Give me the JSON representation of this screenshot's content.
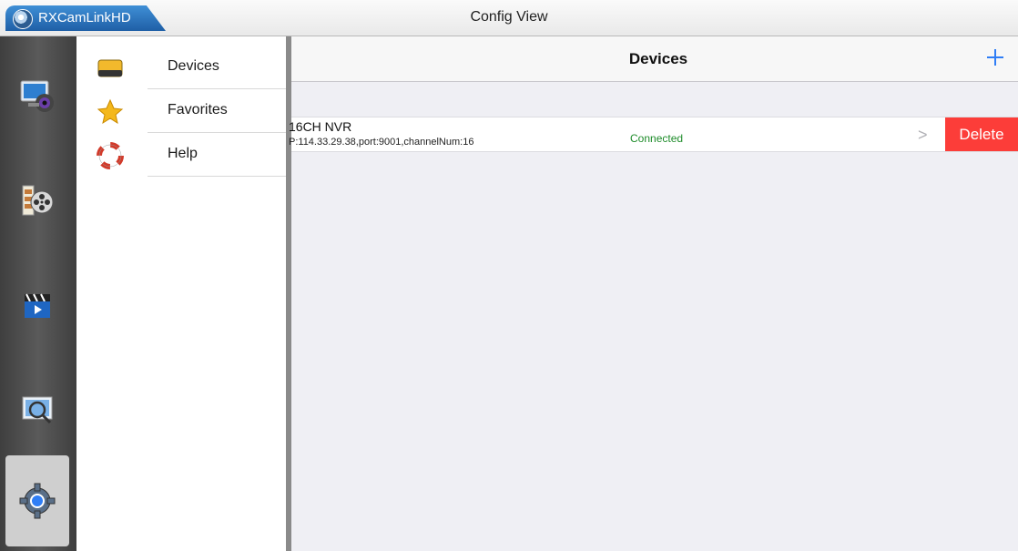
{
  "app": {
    "name": "RXCamLinkHD"
  },
  "window": {
    "title": "Config View"
  },
  "rail": {
    "items": [
      {
        "icon": "monitor-camera-icon"
      },
      {
        "icon": "film-reel-icon"
      },
      {
        "icon": "clapperboard-icon"
      },
      {
        "icon": "search-picture-icon"
      },
      {
        "icon": "settings-gear-icon",
        "active": true
      }
    ]
  },
  "menu": {
    "items": [
      {
        "label": "Devices",
        "icon": "dvr-device-icon"
      },
      {
        "label": "Favorites",
        "icon": "star-icon"
      },
      {
        "label": "Help",
        "icon": "lifebuoy-icon"
      }
    ]
  },
  "main": {
    "title": "Devices",
    "add_icon": "plus-icon",
    "devices": [
      {
        "name": "16CH NVR",
        "info": "P:114.33.29.38,port:9001,channelNum:16",
        "status": "Connected",
        "delete_label": "Delete",
        "chevron": ">"
      }
    ]
  },
  "colors": {
    "accent": "#2f7ef6",
    "delete": "#fc3d39",
    "connected": "#1e8c2a",
    "app_tab": "#2c6fb8"
  }
}
